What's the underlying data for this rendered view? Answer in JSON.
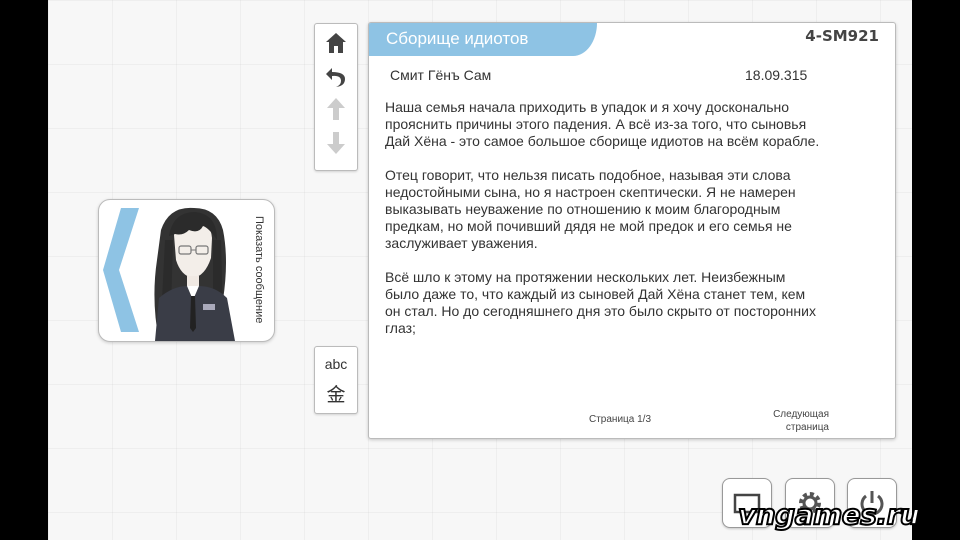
{
  "message": {
    "title": "Сборище идиотов",
    "code": "4-SM921",
    "sender": "Смит Гёнъ Сам",
    "date": "18.09.315",
    "paragraphs": [
      "Наша семья начала приходить в упадок и я хочу досконально\nпрояснить причины этого падения. А всё из-за того, что сыновья\nДай Хёна - это самое большое сборище идиотов на всём корабле.",
      "Отец говорит, что нельзя писать подобное, называя эти слова\nнедостойными сына, но я настроен скептически. Я не намерен\nвыказывать неуважение по отношению к моим благородным\nпредкам, но мой почивший дядя не мой предок и его семья не\nзаслуживает уважения.",
      "Всё шло к этому на протяжении нескольких лет. Неизбежным\nбыло даже то, что каждый из сыновей Дай Хёна станет тем, кем\nон стал. Но до сегодняшнего дня это было скрыто от посторонних\nглаз;"
    ],
    "page_indicator": "Страница 1/3",
    "next_page_label": "Следующая\nстраница"
  },
  "toolbar": {
    "icons": [
      "home-icon",
      "undo-icon",
      "arrow-up-icon",
      "arrow-down-icon"
    ]
  },
  "language_toggle": {
    "latin_label": "abc",
    "kanji_label": "金"
  },
  "character_card": {
    "show_message_label": "Показать сообщение"
  },
  "bottom_buttons": [
    "window-icon",
    "gear-icon",
    "power-icon"
  ],
  "watermark": "vngames.ru",
  "colors": {
    "title_tab": "#8ec3e4",
    "panel_bg": "#ffffff",
    "text": "#333333"
  }
}
